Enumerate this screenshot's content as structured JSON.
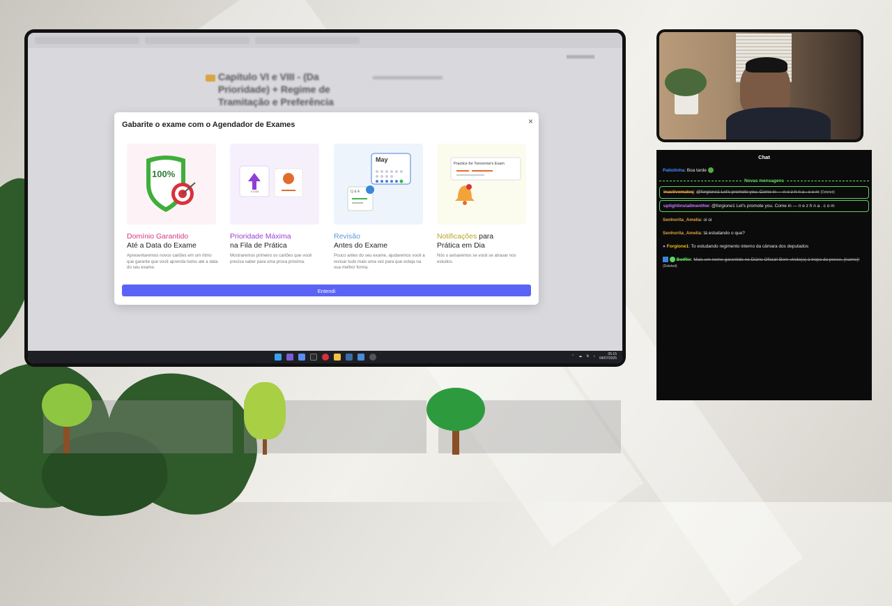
{
  "browser": {
    "page_title": "Capítulo VI e VIII - (Da Prioridade) + Regime de Tramitação e Preferência"
  },
  "modal": {
    "title": "Gabarite o exame com o Agendador de Exames",
    "close_glyph": "×",
    "button_label": "Entendi",
    "cards": [
      {
        "highlight": "Domínio Garantido",
        "highlight_color": "#d63384",
        "title_rest": "",
        "subtitle": "Até a Data do Exame",
        "description": "Apresentaremos novos cartões em um ritmo que garante que você aprenda todos até a data do seu exame.",
        "illus_text": "100%"
      },
      {
        "highlight": "Prioridade Máxima",
        "highlight_color": "#9b3fd6",
        "title_rest": "",
        "subtitle": "na Fila de Prática",
        "description": "Mostraremos primeiro os cartões que você precisa saber para uma prova próxima.",
        "illus_text": "EXAM"
      },
      {
        "highlight": "Revisão",
        "highlight_color": "#5b9bd5",
        "title_rest": "",
        "subtitle": "Antes do Exame",
        "description": "Pouco antes do seu exame, ajudaremos você a revisar tudo mais uma vez para que esteja na sua melhor forma.",
        "illus_text": "May",
        "illus_text2": "Q & A"
      },
      {
        "highlight": "Notificações",
        "highlight_color": "#b8a320",
        "title_rest": " para",
        "subtitle": "Prática em Dia",
        "description": "Nós o avisaremos se você se atrasar nos estudos.",
        "illus_text": "Practice for Tomorrow's Exam"
      }
    ]
  },
  "taskbar": {
    "time": "05:15",
    "date": "04/07/2025"
  },
  "chat": {
    "title": "Chat",
    "divider": "Novas mensagens",
    "messages": [
      {
        "name": "Patiolinha",
        "name_color": "#4a90ff",
        "text": "Boa tarde",
        "deleted": false,
        "highlight": false
      },
      {
        "name": "inactivemateq",
        "name_color": "#e8a33d",
        "text": "@forgione1 Let's promote you. Come  in — n e z h n a . c o m",
        "deleted": true,
        "deleted_tag": "(Deleted)",
        "highlight": true
      },
      {
        "name": "uptightinstallmenthw",
        "name_color": "#c77dff",
        "text": "@forgione1 Let's promote you. Come  in — n e z h n a . c o m",
        "deleted": false,
        "highlight": true
      },
      {
        "name": "Senhorita_Amelia",
        "name_color": "#e8a33d",
        "text": "oi oi",
        "deleted": false,
        "highlight": false
      },
      {
        "name": "Senhorita_Amelia",
        "name_color": "#e8a33d",
        "text": "tá estudando o que?",
        "deleted": false,
        "highlight": false
      },
      {
        "name": "Forgione1",
        "name_color": "#f0c419",
        "text": "To estudando regimento interno da câmara dos deputados",
        "deleted": false,
        "highlight": false
      },
      {
        "name": "BotRix",
        "name_color": "#5fd35f",
        "text": "Mais um nome garantido no Diário Oficial! Bem-vindo(a) à tropa da posse, {name}!",
        "deleted": true,
        "deleted_tag": "(Deleted)",
        "highlight": false
      }
    ]
  }
}
